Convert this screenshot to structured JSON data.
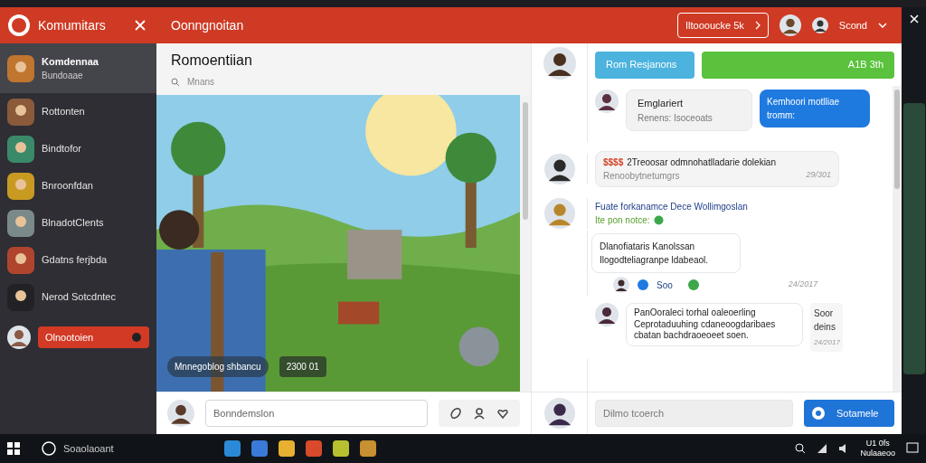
{
  "sidebar": {
    "title": "Komumitars",
    "items": [
      {
        "name": "Komdennaa",
        "subtitle": "Bundoaae",
        "selected": true,
        "color": "#c0762e"
      },
      {
        "name": "Rottonten",
        "selected": false,
        "color": "#8a5a3a"
      },
      {
        "name": "Bindtofor",
        "selected": false,
        "color": "#3a8a6a"
      },
      {
        "name": "Bnroonfdan",
        "selected": false,
        "color": "#c99a22"
      },
      {
        "name": "BlnadotClents",
        "selected": false,
        "color": "#7a8a8a"
      },
      {
        "name": "Gdatns ferjbda",
        "selected": false,
        "color": "#b0452e"
      },
      {
        "name": "Nerod Sotcdntec",
        "selected": false,
        "color": "#222226"
      }
    ],
    "action": "Olnootoien"
  },
  "header": {
    "title": "Oonngnoitan",
    "badge": "Iltoooucke 5k",
    "user": "Scond"
  },
  "post": {
    "title": "Romoentiian",
    "subtitle": "Mnans",
    "caption": "Mnnegoblog shbancu",
    "score": "2300 01",
    "comment_placeholder": "Bonndemslon"
  },
  "chat": {
    "buttons": [
      {
        "label": "Rom Resjanons",
        "color": "#4bb3dd"
      },
      {
        "label": "A1B 3th",
        "color": "#5ac23c"
      }
    ],
    "card": {
      "author": "Emglariert",
      "text": "Renens: Isoceoats"
    },
    "outgoing": "Kemhoori motlliae tromm:",
    "messages": [
      {
        "kind": "bubble",
        "lead": "$$$$",
        "text": "2Treoosar odmnohatlladarie dolekian",
        "sub": "Renoobytnetumgrs",
        "time": "29/301"
      },
      {
        "kind": "notice",
        "title": "Fuate forkanamce Dece Wollimgoslan",
        "sub": "Ite pon notce:"
      },
      {
        "kind": "reply",
        "text": "Dlanofiataris Kanolssan Ilogodteliagranpe ldabeaol.",
        "reaction": "Soo",
        "time": "24/2017"
      },
      {
        "kind": "long",
        "text": "PanOoraleci torhal oaleoerling Ceprotaduuhing cdaneoogdaribaes cbatan bachdraoeoeet soen.",
        "side": "Soor deins",
        "time": "24/2017"
      }
    ],
    "input_placeholder": "Dilmo tcoerch",
    "send": "Sotamele"
  },
  "taskbar": {
    "search": "Soaolaoant",
    "time": "U1 0fs",
    "date": "Nulaaeoo"
  }
}
